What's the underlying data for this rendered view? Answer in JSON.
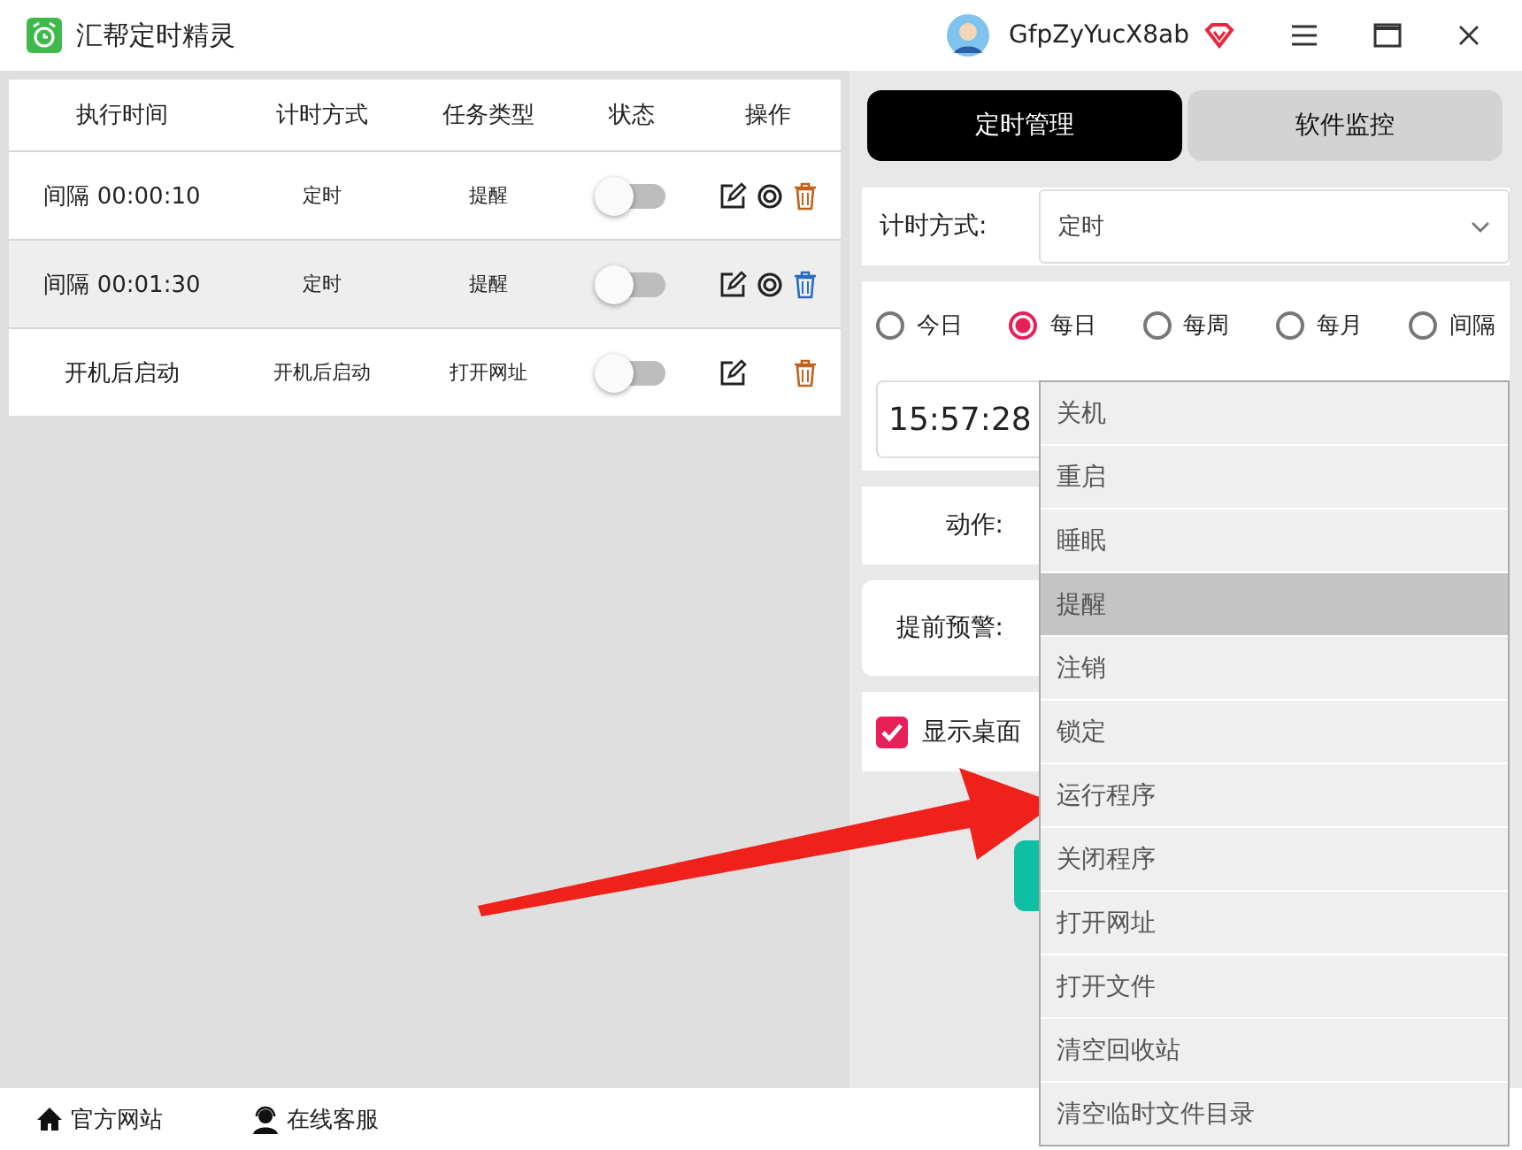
{
  "window": {
    "title": "汇帮定时精灵",
    "username": "GfpZyYucX8ab"
  },
  "table": {
    "columns": [
      "执行时间",
      "计时方式",
      "任务类型",
      "状态",
      "操作"
    ],
    "rows": [
      {
        "time": "间隔 00:00:10",
        "mode": "定时",
        "task": "提醒",
        "on": false,
        "selected": false,
        "preview_icon": true
      },
      {
        "time": "间隔 00:01:30",
        "mode": "定时",
        "task": "提醒",
        "on": false,
        "selected": true,
        "preview_icon": true
      },
      {
        "time": "开机后启动",
        "mode": "开机后启动",
        "task": "打开网址",
        "on": false,
        "selected": false,
        "preview_icon": false
      }
    ]
  },
  "tabs": [
    {
      "label": "定时管理",
      "selected": true
    },
    {
      "label": "软件监控",
      "selected": false
    }
  ],
  "timing": {
    "label": "计时方式:",
    "value": "定时"
  },
  "frequency": [
    {
      "label": "今日",
      "selected": false
    },
    {
      "label": "每日",
      "selected": true
    },
    {
      "label": "每周",
      "selected": false
    },
    {
      "label": "每月",
      "selected": false
    },
    {
      "label": "间隔",
      "selected": false
    }
  ],
  "time_value": "15:57:28",
  "action": {
    "label": "动作:"
  },
  "warning": {
    "label": "提前预警:"
  },
  "desktop": {
    "label": "显示桌面",
    "checked": true
  },
  "menu": [
    {
      "label": "关机",
      "selected": false
    },
    {
      "label": "重启",
      "selected": false
    },
    {
      "label": "睡眠",
      "selected": false
    },
    {
      "label": "提醒",
      "selected": true
    },
    {
      "label": "注销",
      "selected": false
    },
    {
      "label": "锁定",
      "selected": false
    },
    {
      "label": "运行程序",
      "selected": false
    },
    {
      "label": "关闭程序",
      "selected": false
    },
    {
      "label": "打开网址",
      "selected": false
    },
    {
      "label": "打开文件",
      "selected": false
    },
    {
      "label": "清空回收站",
      "selected": false
    },
    {
      "label": "清空临时文件目录",
      "selected": false
    }
  ],
  "footer": [
    {
      "label": "官方网站",
      "kind": "home"
    },
    {
      "label": "在线客服",
      "kind": "support"
    }
  ]
}
